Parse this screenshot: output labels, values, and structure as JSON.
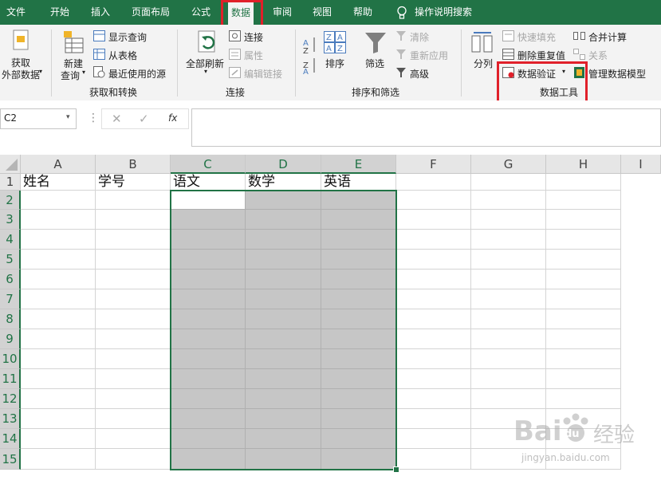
{
  "tabs": [
    {
      "label": "文件"
    },
    {
      "label": "开始"
    },
    {
      "label": "插入"
    },
    {
      "label": "页面布局"
    },
    {
      "label": "公式"
    },
    {
      "label": "数据"
    },
    {
      "label": "审阅"
    },
    {
      "label": "视图"
    },
    {
      "label": "帮助"
    }
  ],
  "tell_me": "操作说明搜索",
  "ribbon": {
    "get_data": [
      "获取",
      "外部数据"
    ],
    "new_query": [
      "新建",
      "查询"
    ],
    "show_query": "显示查询",
    "from_table": "从表格",
    "recent_sources": "最近使用的源",
    "group_get_transform": "获取和转换",
    "refresh_all": "全部刷新",
    "connections": "连接",
    "properties": "属性",
    "edit_links": "编辑链接",
    "group_connections": "连接",
    "sort": "排序",
    "filter": "筛选",
    "clear": "清除",
    "reapply": "重新应用",
    "advanced": "高级",
    "group_sort_filter": "排序和筛选",
    "text_to_columns": "分列",
    "flash_fill": "快速填充",
    "remove_duplicates": "删除重复值",
    "data_validation": "数据验证",
    "consolidate": "合并计算",
    "relationships": "关系",
    "manage_data_model": "管理数据模型",
    "group_data_tools": "数据工具"
  },
  "name_box": "C2",
  "fx": "fx",
  "columns": [
    "A",
    "B",
    "C",
    "D",
    "E",
    "F",
    "G",
    "H",
    "I"
  ],
  "rows": [
    "1",
    "2",
    "3",
    "4",
    "5",
    "6",
    "7",
    "8",
    "9",
    "10",
    "11",
    "12",
    "13",
    "14",
    "15"
  ],
  "headers": [
    "姓名",
    "学号",
    "语文",
    "数学",
    "英语"
  ],
  "colors": {
    "excel_green": "#217346",
    "highlight_red": "#e0202a",
    "selection_fill": "#c6c6c6"
  },
  "watermark": {
    "brand": "Bai",
    "paw": "du",
    "cn": "经验",
    "url": "jingyan.baidu.com"
  }
}
